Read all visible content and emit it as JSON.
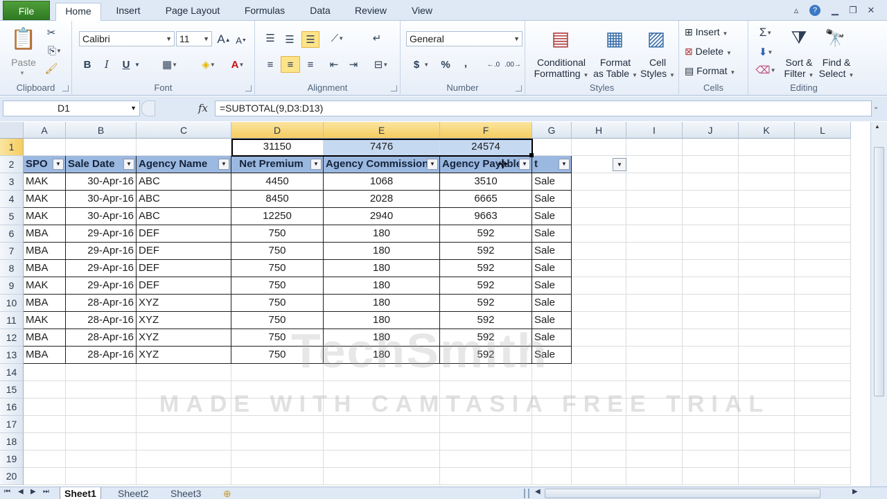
{
  "tabs": [
    "File",
    "Home",
    "Insert",
    "Page Layout",
    "Formulas",
    "Data",
    "Review",
    "View"
  ],
  "ribbon": {
    "clipboard": {
      "paste": "Paste",
      "label": "Clipboard"
    },
    "font": {
      "name": "Calibri",
      "size": "11",
      "bold": "B",
      "italic": "I",
      "underline": "U",
      "label": "Font"
    },
    "alignment": {
      "label": "Alignment"
    },
    "number": {
      "format": "General",
      "currency": "$",
      "percent": "%",
      "comma": ",",
      "label": "Number"
    },
    "styles": {
      "conditional_1": "Conditional",
      "conditional_2": "Formatting",
      "format_table_1": "Format",
      "format_table_2": "as Table",
      "cell_styles_1": "Cell",
      "cell_styles_2": "Styles",
      "label": "Styles"
    },
    "cells": {
      "insert": "Insert",
      "delete": "Delete",
      "format": "Format",
      "label": "Cells"
    },
    "editing": {
      "sigma": "Σ",
      "sort_1": "Sort &",
      "sort_2": "Filter",
      "find_1": "Find &",
      "find_2": "Select",
      "label": "Editing"
    }
  },
  "formula_bar": {
    "name_box": "D1",
    "fx": "fx",
    "formula": "=SUBTOTAL(9,D3:D13)"
  },
  "columns": [
    "A",
    "B",
    "C",
    "D",
    "E",
    "F",
    "G",
    "H",
    "I",
    "J",
    "K",
    "L"
  ],
  "rows": [
    "1",
    "2",
    "3",
    "4",
    "5",
    "6",
    "7",
    "8",
    "9",
    "10",
    "11",
    "12",
    "13",
    "14",
    "15",
    "16",
    "17",
    "18",
    "19",
    "20"
  ],
  "totals": {
    "d": "31150",
    "e": "7476",
    "f": "24574"
  },
  "table_headers": [
    "SPO",
    "Sale Date",
    "Agency Name",
    "Net Premium",
    "Agency Commission",
    "Agency Payable",
    "t"
  ],
  "table_rows": [
    [
      "MAK",
      "30-Apr-16",
      "ABC",
      "4450",
      "1068",
      "3510",
      "Sale"
    ],
    [
      "MAK",
      "30-Apr-16",
      "ABC",
      "8450",
      "2028",
      "6665",
      "Sale"
    ],
    [
      "MAK",
      "30-Apr-16",
      "ABC",
      "12250",
      "2940",
      "9663",
      "Sale"
    ],
    [
      "MBA",
      "29-Apr-16",
      "DEF",
      "750",
      "180",
      "592",
      "Sale"
    ],
    [
      "MBA",
      "29-Apr-16",
      "DEF",
      "750",
      "180",
      "592",
      "Sale"
    ],
    [
      "MBA",
      "29-Apr-16",
      "DEF",
      "750",
      "180",
      "592",
      "Sale"
    ],
    [
      "MAK",
      "29-Apr-16",
      "DEF",
      "750",
      "180",
      "592",
      "Sale"
    ],
    [
      "MBA",
      "28-Apr-16",
      "XYZ",
      "750",
      "180",
      "592",
      "Sale"
    ],
    [
      "MAK",
      "28-Apr-16",
      "XYZ",
      "750",
      "180",
      "592",
      "Sale"
    ],
    [
      "MBA",
      "28-Apr-16",
      "XYZ",
      "750",
      "180",
      "592",
      "Sale"
    ],
    [
      "MBA",
      "28-Apr-16",
      "XYZ",
      "750",
      "180",
      "592",
      "Sale"
    ]
  ],
  "sheets": [
    "Sheet1",
    "Sheet2",
    "Sheet3"
  ],
  "watermark": {
    "line1": "TechSmith",
    "line2": "MADE WITH CAMTASIA FREE TRIAL"
  },
  "colors": {
    "header_fill": "#9bb8e0",
    "selection": "#c5d9f1",
    "active_col": "#f5cc5e"
  }
}
